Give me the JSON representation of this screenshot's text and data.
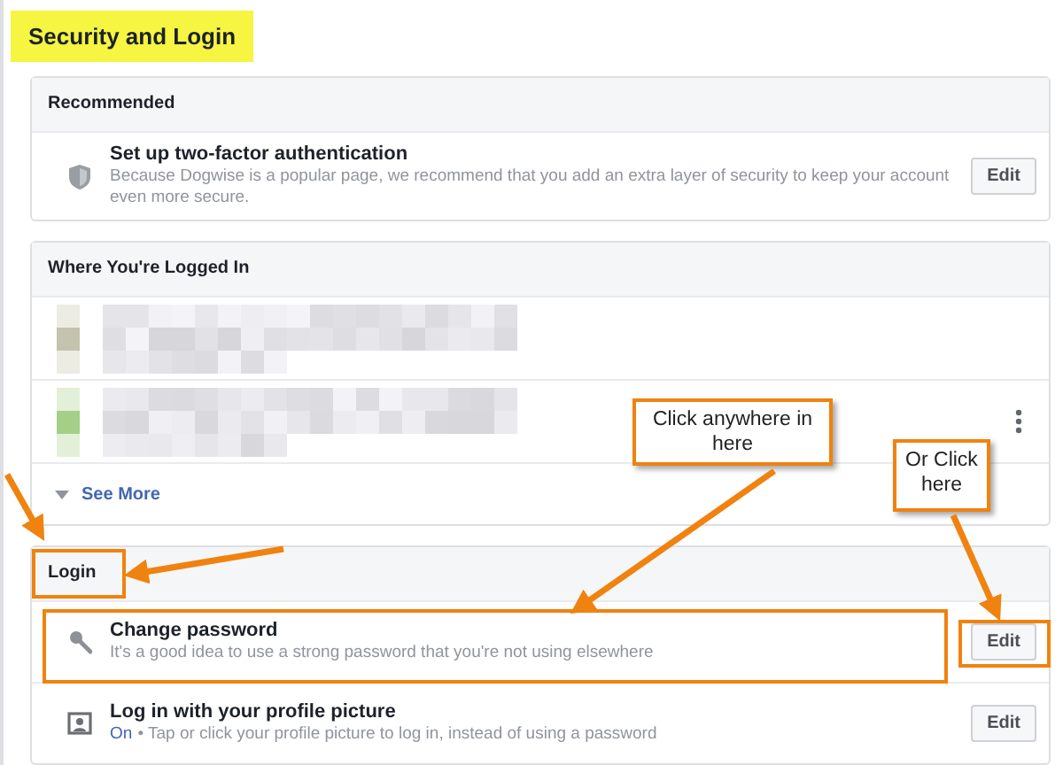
{
  "title": "Security and Login",
  "sections": [
    {
      "header": "Recommended",
      "rows": [
        {
          "kind": "setting",
          "title": "Set up two-factor authentication",
          "description": "Because Dogwise is a popular page, we recommend that you add an extra layer of security to keep your account even more secure.",
          "button": "Edit"
        }
      ]
    },
    {
      "header": "Where You're Logged In",
      "rows": [
        {
          "kind": "session",
          "menu": false
        },
        {
          "kind": "session",
          "menu": true
        },
        {
          "kind": "more",
          "label": "See More"
        }
      ]
    },
    {
      "header": "Login",
      "rows": [
        {
          "kind": "setting",
          "title": "Change password",
          "description": "It's a good idea to use a strong password that you're not using elsewhere",
          "button": "Edit"
        },
        {
          "kind": "setting",
          "title": "Log in with your profile picture",
          "status": "On",
          "description": "• Tap or click your profile picture to log in, instead of using a password",
          "button": "Edit"
        }
      ]
    }
  ],
  "callouts": [
    {
      "text": "Click anywhere in here"
    },
    {
      "text": "Or Click here"
    }
  ]
}
